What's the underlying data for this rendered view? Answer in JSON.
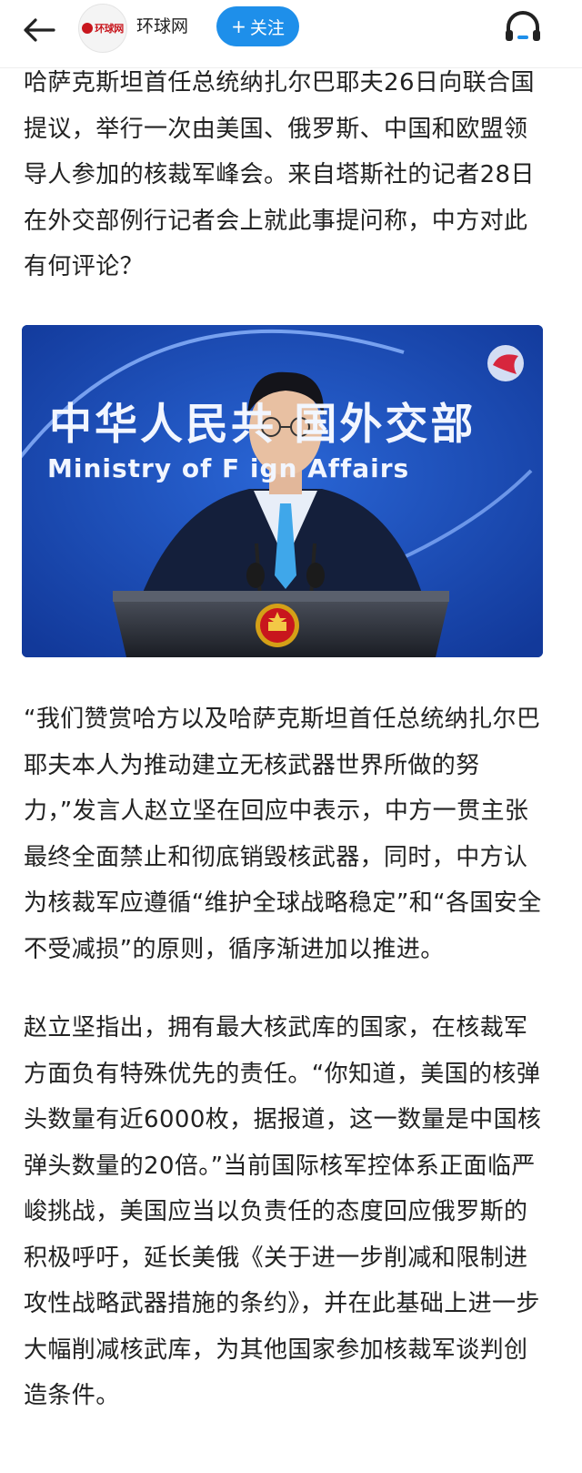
{
  "header": {
    "back_icon": "arrow-left-icon",
    "source_name": "环球网",
    "avatar_logo_text": "环球网",
    "follow_label": "关注",
    "follow_plus": "+",
    "listen_icon": "headphones-icon",
    "accent_color": "#1e8fea"
  },
  "article": {
    "paragraphs": [
      "哈萨克斯坦首任总统纳扎尔巴耶夫26日向联合国提议，举行一次由美国、俄罗斯、中国和欧盟领导人参加的核裁军峰会。来自塔斯社的记者28日在外交部例行记者会上就此事提问称，中方对此有何评论？",
      "“我们赞赏哈方以及哈萨克斯坦首任总统纳扎尔巴耶夫本人为推动建立无核武器世界所做的努力，”发言人赵立坚在回应中表示，中方一贯主张最终全面禁止和彻底销毁核武器，同时，中方认为核裁军应遵循“维护全球战略稳定”和“各国安全不受减损”的原则，循序渐进加以推进。",
      "赵立坚指出，拥有最大核武库的国家，在核裁军方面负有特殊优先的责任。“你知道，美国的核弹头数量有近6000枚，据报道，这一数量是中国核弹头数量的20倍。”当前国际核军控体系正面临严峻挑战，美国应当以负责任的态度回应俄罗斯的积极呼吁，延长美俄《关于进一步削减和限制进攻性战略武器措施的条约》，并在此基础上进一步大幅削减核武库，为其他国家参加核裁军谈判创造条件。"
    ],
    "photo": {
      "backdrop_cn": "中华人民共 国外交部",
      "backdrop_en": "Ministry of F    ign Affairs",
      "backdrop_color": "#1d50b8"
    }
  }
}
